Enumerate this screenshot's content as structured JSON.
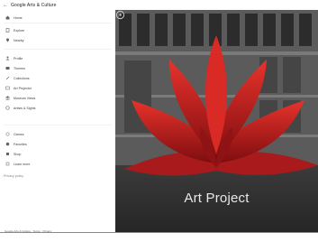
{
  "header": {
    "back_icon": "arrow-left-icon",
    "title": "Google Arts & Culture"
  },
  "sidebar": {
    "items": [
      {
        "label": "Home",
        "icon": "home-icon"
      },
      {
        "label": "Explore",
        "icon": "explore-icon"
      },
      {
        "label": "Nearby",
        "icon": "nearby-icon"
      },
      {
        "label": "Profile",
        "icon": "profile-icon"
      },
      {
        "label": "Themes",
        "icon": "themes-icon"
      },
      {
        "label": "Collections",
        "icon": "collections-icon"
      },
      {
        "label": "Art Projector",
        "icon": "projector-icon"
      },
      {
        "label": "Museum Views",
        "icon": "museum-icon"
      },
      {
        "label": "Artists & Sights",
        "icon": "artist-icon"
      },
      {
        "label": "Games",
        "icon": "games-icon"
      },
      {
        "label": "Favorites",
        "icon": "star-icon"
      },
      {
        "label": "Shop",
        "icon": "shop-icon"
      },
      {
        "label": "Learn more",
        "icon": "info-icon"
      },
      {
        "label": "Privacy policy",
        "icon": ""
      }
    ],
    "footer_link": "Google Arts & Culture · Terms · Privacy"
  },
  "hero": {
    "title": "Art Project",
    "icon": "compass-icon"
  },
  "colors": {
    "accent": "#c8191b",
    "hero_text": "#e8e8e8"
  }
}
